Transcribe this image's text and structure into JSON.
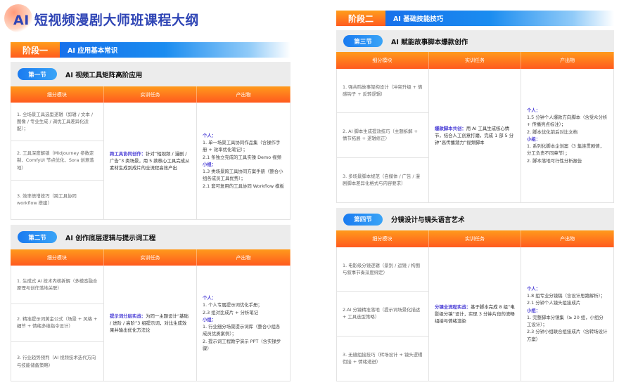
{
  "page_title": "AI 短视频漫剧大师班课程大纲",
  "colors": {
    "title": "#2f45b5",
    "stage_orange": "#ff5b1f",
    "banner_blue": "#1664e8",
    "highlight": "#4b3fd6"
  },
  "stages": [
    {
      "label": "阶段一",
      "title": "AI 应用基本常识",
      "sections": [
        {
          "badge": "第一节",
          "title": "AI 视频工具矩阵高阶应用",
          "headers": [
            "细分模块",
            "实训任务",
            "产出物"
          ],
          "modules": [
            "1. 全场景工具选型逻辑（剪辑 / 文本 / 图像 / 专业生成 / 调优工具差异化适配）；",
            "2. 工具深度解锁（Midjourney 参数定制、ComfyUI 节点优化、Sora 创意落地）",
            "3. 效率倍增技巧（跨工具协同 workflow 搭建）"
          ],
          "task": {
            "label": "跨工具协同创作：",
            "text": "针对“短视频 / 漫剧 / 广告”3 类场景，用 5 款核心工具完成从素材生成到成片的全流程高效产出"
          },
          "output": {
            "personal_label": "个人：",
            "personal": [
              "1. 单一场景工具协同作品集（含操作手册 + 效率优化笔记）；",
              "2.1 条独立完成的工具实操 Demo 视频"
            ],
            "group_label": "小组：",
            "group": [
              "1.3 类场景跨工具协同方案手册（整合小组各成员工具优势）；",
              "2.1 套可复用的工具协同 Workflow 模板"
            ]
          }
        },
        {
          "badge": "第二节",
          "title": "AI 创作底层逻辑与提示词工程",
          "headers": [
            "细分模块",
            "实训任务",
            "产出物"
          ],
          "modules": [
            "1. 生成式 AI 技术内核拆解（多模态融合原理与创作落地关联）",
            "2. 精准提示词黄金公式（场景 + 风格 + 细节 + 情绪多维指令设计）",
            "3. 行业趋势预判（AI 视频技术迭代方向与技能储备策略）"
          ],
          "task": {
            "label": "提示词分层实战：",
            "text": "为同一主题设计“基础 / 进阶 / 高阶”3 组提示词，对比生成效果并输出优化方法论"
          },
          "output": {
            "personal_label": "个人：",
            "personal": [
              "1. 个人专属提示词优化手册；",
              "2.3 组对比成片 + 分析笔记"
            ],
            "group_label": "小组：",
            "group": [
              "1. 行业细分场景提示词库（整合小组各成员优质案例）；",
              "2. 提示词工程教学演示 PPT（含实操步骤）"
            ]
          }
        }
      ]
    },
    {
      "label": "阶段二",
      "title": "AI 基础技能技巧",
      "sections": [
        {
          "badge": "第三节",
          "title": "AI 赋能故事脚本爆款创作",
          "headers": [
            "细分模块",
            "实训任务",
            "产出物"
          ],
          "modules": [
            "1. 强共鸣故事架构设计（冲突升级 + 情感钩子 + 反转逻辑）",
            "2. AI 脚本生成提效技巧（主题拆解 + 情节拓展 + 逻辑修正）",
            "3. 多场景脚本规范（自媒体 / 广告 / 漫剧脚本差异化格式与内容要求）"
          ],
          "task": {
            "label": "爆款脚本共创：",
            "text": "用 AI 工具生成核心情节，结合人工创意打磨，完成 1 部 5 分钟“高传播潜力”视频脚本"
          },
          "output": {
            "personal_label": "个人：",
            "personal": [
              "1.5 分钟个人爆款方向脚本（含受众分析 + 传播亮点标注）；",
              "2. 脚本优化前后对比文档"
            ],
            "group_label": "小组：",
            "group": [
              "1. 系列化脚本企划案（3 集连贯剧情，分工负责不同章节）；",
              "2. 脚本落地可行性分析报告"
            ]
          }
        },
        {
          "badge": "第四节",
          "title": "分镜设计与镜头语言艺术",
          "headers": [
            "细分模块",
            "实训任务",
            "产出物"
          ],
          "modules": [
            "1. 电影级分镜逻辑（景别 / 运镜 / 构图与叙事节奏深度绑定）",
            "2.AI 分镜精准落地（提示词场景化描述 + 工具选型策略）",
            "3. 无缝组接技巧（转场设计 + 镜头逻辑衔接 + 情绪递进）"
          ],
          "task": {
            "label": "分镜全流程实战：",
            "text": "基于脚本完成 8 组“电影级分镜”设计，实现 3 分钟片段的流畅组接与情绪渲染"
          },
          "output": {
            "personal_label": "个人：",
            "personal": [
              "1.8 组专业分镜稿（含设计思路解析）；",
              "2.1 分钟个人镜头组接成片"
            ],
            "group_label": "小组：",
            "group": [
              "1. 完整脚本分镜集（≥ 20 组，小组分工设计）；",
              "2.3 分钟小组联合组接成片（含转场设计方案）"
            ]
          }
        }
      ]
    }
  ]
}
